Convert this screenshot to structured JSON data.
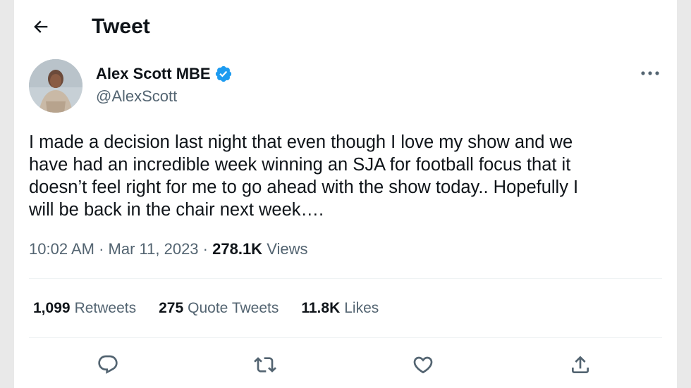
{
  "header": {
    "back_icon": "arrow-left-icon",
    "title": "Tweet"
  },
  "author": {
    "display_name": "Alex Scott MBE",
    "handle": "@AlexScott",
    "verified_icon": "verified-badge-icon",
    "verified_color": "#1d9bf0"
  },
  "tweet": {
    "text": "I made a decision last night that even though I love my show and we\nhave had an incredible week winning an SJA for football focus that it\ndoesn’t feel right for me to go ahead with the show today.. Hopefully I\nwill be back in the chair next week….",
    "time": "10:02 AM",
    "date": "Mar 11, 2023",
    "separator": "·",
    "views_count": "278.1K",
    "views_label": "Views"
  },
  "stats": [
    {
      "count": "1,099",
      "label": "Retweets"
    },
    {
      "count": "275",
      "label": "Quote Tweets"
    },
    {
      "count": "11.8K",
      "label": "Likes"
    }
  ],
  "actions": [
    {
      "icon": "reply-icon"
    },
    {
      "icon": "retweet-icon"
    },
    {
      "icon": "like-icon"
    },
    {
      "icon": "share-icon"
    }
  ],
  "more_icon": "more-options-icon"
}
